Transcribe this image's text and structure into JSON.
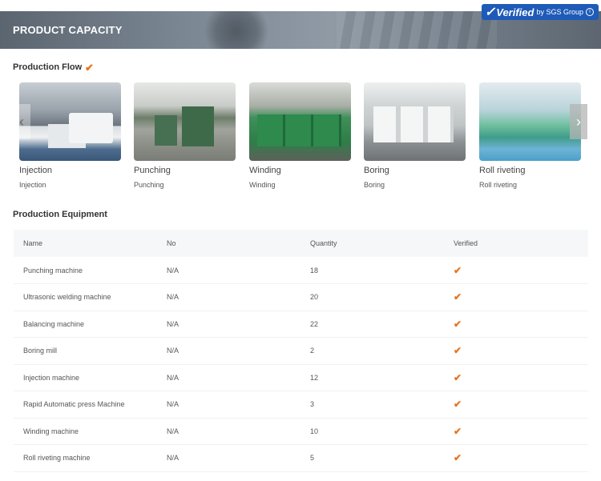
{
  "banner": {
    "title": "PRODUCT CAPACITY",
    "verified_label": "Verified",
    "verified_by": "by SGS Group",
    "info_glyph": "i"
  },
  "flow": {
    "title": "Production Flow",
    "check": "✔",
    "items": [
      {
        "label": "Injection",
        "sub": "Injection"
      },
      {
        "label": "Punching",
        "sub": "Punching"
      },
      {
        "label": "Winding",
        "sub": "Winding"
      },
      {
        "label": "Boring",
        "sub": "Boring"
      },
      {
        "label": "Roll riveting",
        "sub": "Roll riveting"
      }
    ],
    "prev_glyph": "‹",
    "next_glyph": "›"
  },
  "equipment": {
    "title": "Production Equipment",
    "headers": {
      "name": "Name",
      "no": "No",
      "quantity": "Quantity",
      "verified": "Verified"
    },
    "check": "✔",
    "rows": [
      {
        "name": "Punching machine",
        "no": "N/A",
        "quantity": "18"
      },
      {
        "name": "Ultrasonic welding machine",
        "no": "N/A",
        "quantity": "20"
      },
      {
        "name": "Balancing machine",
        "no": "N/A",
        "quantity": "22"
      },
      {
        "name": "Boring mill",
        "no": "N/A",
        "quantity": "2"
      },
      {
        "name": "Injection machine",
        "no": "N/A",
        "quantity": "12"
      },
      {
        "name": "Rapid Automatic press Machine",
        "no": "N/A",
        "quantity": "3"
      },
      {
        "name": "Winding machine",
        "no": "N/A",
        "quantity": "10"
      },
      {
        "name": "Roll riveting machine",
        "no": "N/A",
        "quantity": "5"
      }
    ]
  },
  "colors": {
    "accent_orange": "#e8731c",
    "verified_blue": "#1e5bb8"
  }
}
